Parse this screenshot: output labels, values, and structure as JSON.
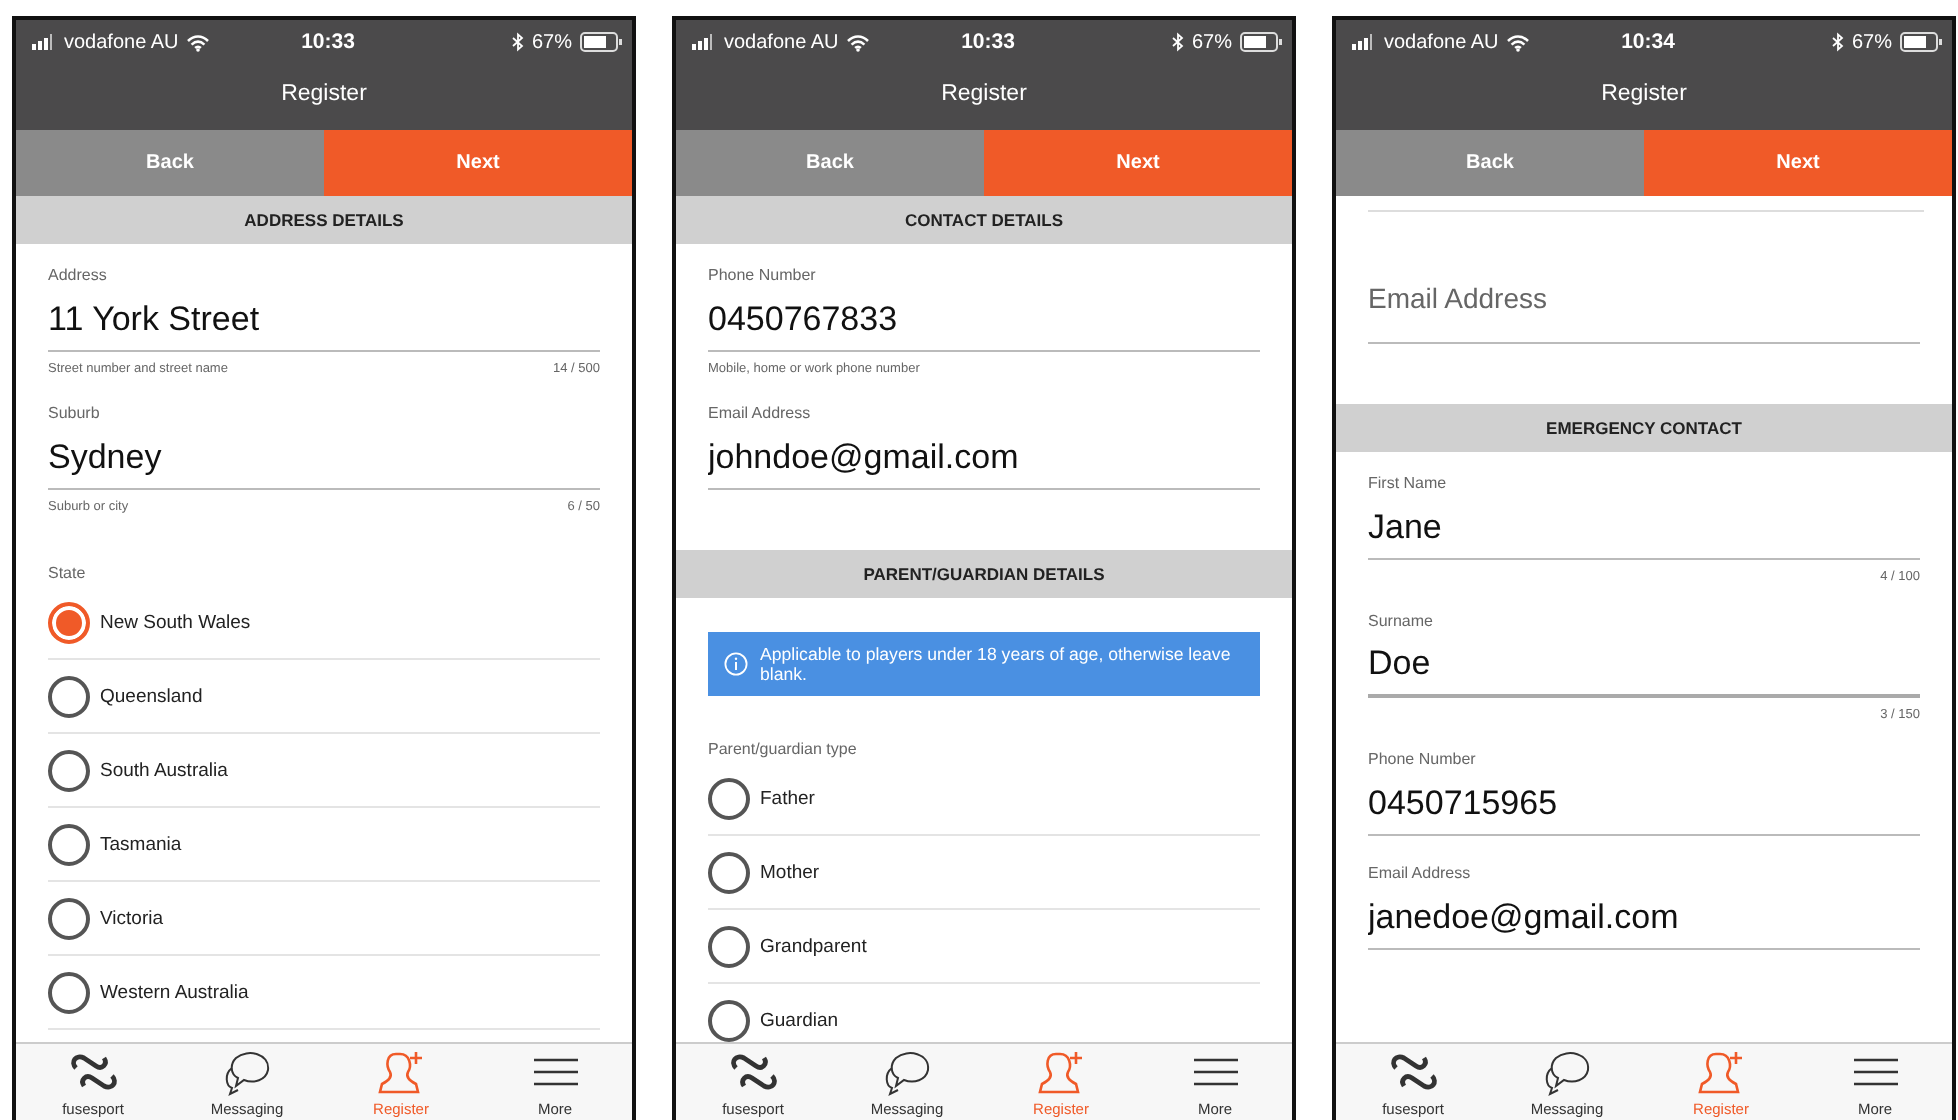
{
  "phones": [
    {
      "status_bar": {
        "carrier": "vodafone AU",
        "time": "10:33",
        "battery": "67%"
      },
      "title": "Register",
      "back_button": "Back",
      "next_button": "Next",
      "scrolled": false,
      "sections": [
        {
          "header": "ADDRESS DETAILS",
          "items": [
            {
              "kind": "field",
              "label": "Address",
              "value": "11 York Street",
              "hint": "Street number and street name",
              "counter": "14 / 500",
              "focused": false
            },
            {
              "kind": "field",
              "label": "Suburb",
              "value": "Sydney",
              "hint": "Suburb or city",
              "counter": "6 / 50",
              "focused": false
            },
            {
              "kind": "radio_group",
              "label": "State",
              "options": [
                {
                  "label": "New South Wales",
                  "selected": true
                },
                {
                  "label": "Queensland",
                  "selected": false
                },
                {
                  "label": "South Australia",
                  "selected": false
                },
                {
                  "label": "Tasmania",
                  "selected": false
                },
                {
                  "label": "Victoria",
                  "selected": false
                },
                {
                  "label": "Western Australia",
                  "selected": false
                }
              ]
            }
          ]
        }
      ],
      "tab_bar": [
        {
          "label": "fusesport",
          "selected": false
        },
        {
          "label": "Messaging",
          "selected": false
        },
        {
          "label": "Register",
          "selected": true
        },
        {
          "label": "More",
          "selected": false
        }
      ]
    },
    {
      "status_bar": {
        "carrier": "vodafone AU",
        "time": "10:33",
        "battery": "67%"
      },
      "title": "Register",
      "back_button": "Back",
      "next_button": "Next",
      "scrolled": false,
      "sections": [
        {
          "header": "CONTACT DETAILS",
          "items": [
            {
              "kind": "field",
              "label": "Phone Number",
              "value": "0450767833",
              "hint": "Mobile, home or work phone number",
              "focused": false
            },
            {
              "kind": "field",
              "label": "Email Address",
              "value": "johndoe@gmail.com",
              "focused": false
            }
          ]
        },
        {
          "header": "PARENT/GUARDIAN DETAILS",
          "items": [
            {
              "kind": "notice",
              "text": "Applicable to players under 18 years of age, otherwise leave blank."
            },
            {
              "kind": "radio_group",
              "label": "Parent/guardian type",
              "options": [
                {
                  "label": "Father",
                  "selected": false
                },
                {
                  "label": "Mother",
                  "selected": false
                },
                {
                  "label": "Grandparent",
                  "selected": false
                },
                {
                  "label": "Guardian",
                  "selected": false
                }
              ]
            }
          ]
        }
      ],
      "tab_bar": [
        {
          "label": "fusesport",
          "selected": false
        },
        {
          "label": "Messaging",
          "selected": false
        },
        {
          "label": "Register",
          "selected": true
        },
        {
          "label": "More",
          "selected": false
        }
      ]
    },
    {
      "status_bar": {
        "carrier": "vodafone AU",
        "time": "10:34",
        "battery": "67%"
      },
      "title": "Register",
      "back_button": "Back",
      "next_button": "Next",
      "scrolled": true,
      "sections": [
        {
          "items": [
            {
              "kind": "field",
              "placeholder": "Email Address",
              "focused": false
            }
          ]
        },
        {
          "header": "EMERGENCY CONTACT",
          "items": [
            {
              "kind": "field",
              "label": "First Name",
              "value": "Jane",
              "counter": "4 / 100",
              "focused": false
            },
            {
              "kind": "field",
              "label": "Surname",
              "value": "Doe",
              "counter": "3 / 150",
              "focused": true
            },
            {
              "kind": "field",
              "label": "Phone Number",
              "value": "0450715965",
              "focused": false
            },
            {
              "kind": "field",
              "label": "Email Address",
              "value": "janedoe@gmail.com",
              "focused": false
            }
          ]
        }
      ],
      "tab_bar": [
        {
          "label": "fusesport",
          "selected": false
        },
        {
          "label": "Messaging",
          "selected": false
        },
        {
          "label": "Register",
          "selected": true
        },
        {
          "label": "More",
          "selected": false
        }
      ]
    }
  ]
}
